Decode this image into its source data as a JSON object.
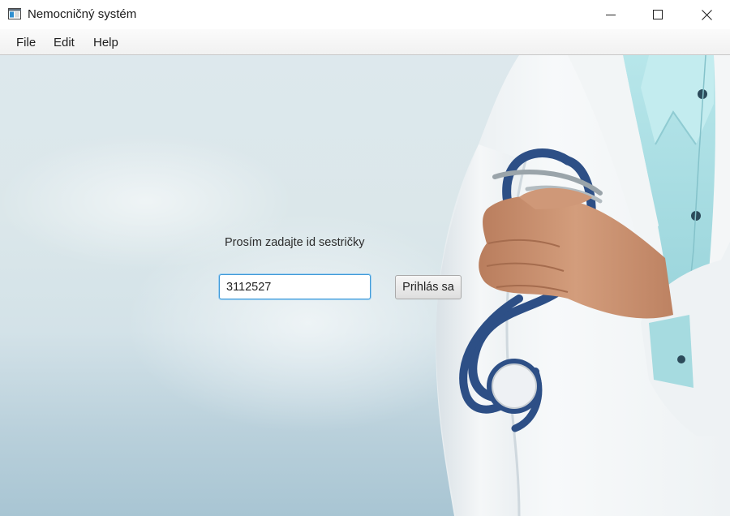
{
  "window": {
    "title": "Nemocničný systém",
    "icon": "application-window-icon",
    "controls": [
      "minimize-icon",
      "maximize-icon",
      "close-icon"
    ]
  },
  "menu": {
    "items": [
      {
        "label": "File"
      },
      {
        "label": "Edit"
      },
      {
        "label": "Help"
      }
    ]
  },
  "login": {
    "prompt": "Prosím zadajte id sestričky",
    "nurse_id_value": "3112527",
    "submit_label": "Prihlás sa"
  },
  "background": {
    "subject": "doctor-with-stethoscope-photo",
    "colors": {
      "backdrop": "#d3e2e8",
      "coat": "#f4f6f7",
      "shirt": "#a8dde2",
      "stethoscope": "#2d4f86",
      "skin": "#c9906e"
    }
  }
}
